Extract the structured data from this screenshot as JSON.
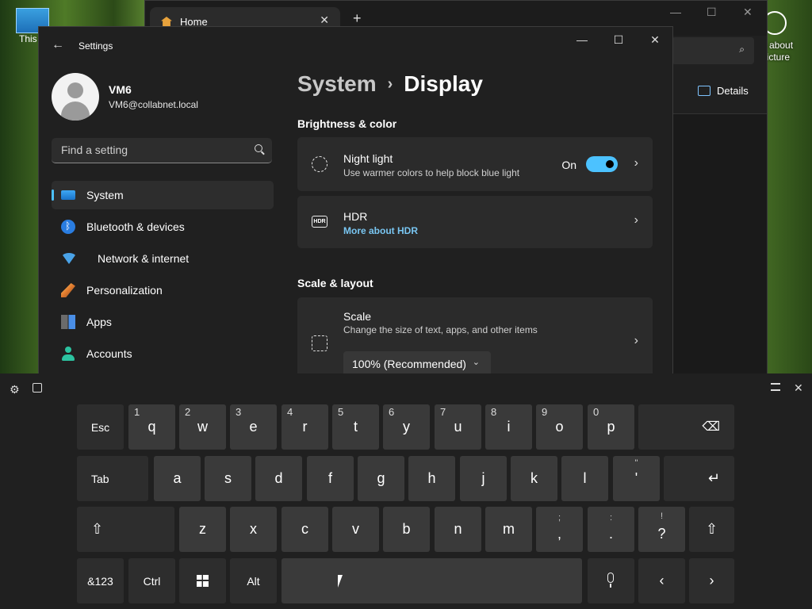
{
  "desktop": {
    "left_icon_label": "This P",
    "right_icon_label": "n about picture"
  },
  "browser": {
    "tab_title": "Home",
    "tab_close": "✕",
    "new_tab": "+",
    "details_label": "Details",
    "min": "—",
    "max": "☐",
    "close": "✕"
  },
  "settings": {
    "window_title": "Settings",
    "back": "←",
    "min": "—",
    "max": "☐",
    "close": "✕",
    "user": {
      "name": "VM6",
      "email": "VM6@collabnet.local"
    },
    "search_placeholder": "Find a setting",
    "nav": [
      {
        "label": "System",
        "icon": "monitor-icon",
        "active": true
      },
      {
        "label": "Bluetooth & devices",
        "icon": "bluetooth-icon"
      },
      {
        "label": "Network & internet",
        "icon": "wifi-icon"
      },
      {
        "label": "Personalization",
        "icon": "brush-icon"
      },
      {
        "label": "Apps",
        "icon": "apps-icon"
      },
      {
        "label": "Accounts",
        "icon": "person-icon"
      }
    ],
    "breadcrumb": {
      "parent": "System",
      "sep": "›",
      "current": "Display"
    },
    "sections": {
      "brightness": "Brightness & color",
      "scale": "Scale & layout"
    },
    "night_light": {
      "title": "Night light",
      "subtitle": "Use warmer colors to help block blue light",
      "state": "On"
    },
    "hdr": {
      "title": "HDR",
      "link": "More about HDR",
      "icon_text": "HDR"
    },
    "scale_card": {
      "title": "Scale",
      "subtitle": "Change the size of text, apps, and other items",
      "value": "100% (Recommended)"
    },
    "chevron": "›"
  },
  "keyboard": {
    "settings_icon": "⚙",
    "row1": [
      {
        "k": "Esc"
      },
      {
        "k": "q",
        "h": "1"
      },
      {
        "k": "w",
        "h": "2"
      },
      {
        "k": "e",
        "h": "3"
      },
      {
        "k": "r",
        "h": "4"
      },
      {
        "k": "t",
        "h": "5"
      },
      {
        "k": "y",
        "h": "6"
      },
      {
        "k": "u",
        "h": "7"
      },
      {
        "k": "i",
        "h": "8"
      },
      {
        "k": "o",
        "h": "9"
      },
      {
        "k": "p",
        "h": "0"
      },
      {
        "k": "⌫"
      }
    ],
    "row2": [
      "Tab",
      "a",
      "s",
      "d",
      "f",
      "g",
      "h",
      "j",
      "k",
      "l",
      "'",
      "↵"
    ],
    "row2_quote_hint": "\"",
    "row3": [
      "⇧",
      "z",
      "x",
      "c",
      "v",
      "b",
      "n",
      "m",
      ",",
      ".",
      "?",
      "⇧"
    ],
    "row3_hints": {
      "comma": ";",
      "period": ":",
      "question": "!"
    },
    "row4": {
      "sym": "&123",
      "ctrl": "Ctrl",
      "alt": "Alt",
      "left": "‹",
      "right": "›"
    }
  }
}
